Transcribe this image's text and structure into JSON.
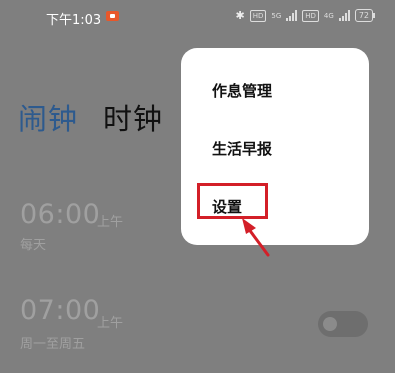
{
  "status_bar": {
    "time": "下午1:03",
    "bluetooth_icon": "bluetooth-icon",
    "hd_label_1": "HD",
    "net_label_1": "5G",
    "hd_label_2": "HD",
    "net_label_2": "4G",
    "battery": "72"
  },
  "tabs": {
    "alarm": "闹钟",
    "clock": "时钟"
  },
  "alarms": [
    {
      "time": "06:00",
      "ampm": "上午",
      "repeat": "每天"
    },
    {
      "time": "07:00",
      "ampm": "上午",
      "repeat": "周一至周五"
    }
  ],
  "menu": {
    "items": [
      "作息管理",
      "生活早报",
      "设置"
    ]
  },
  "colors": {
    "overlay": "#7f7f7f",
    "accent": "#2d5a8e",
    "highlight": "#d31f28"
  }
}
